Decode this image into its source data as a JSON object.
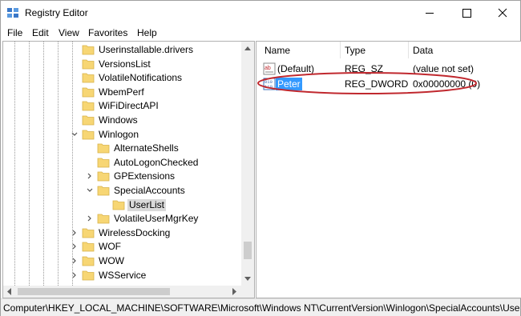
{
  "window": {
    "title": "Registry Editor"
  },
  "menu": [
    "File",
    "Edit",
    "View",
    "Favorites",
    "Help"
  ],
  "tree": {
    "items": [
      {
        "label": "Userinstallable.drivers",
        "expander": "none"
      },
      {
        "label": "VersionsList",
        "expander": "none"
      },
      {
        "label": "VolatileNotifications",
        "expander": "none"
      },
      {
        "label": "WbemPerf",
        "expander": "none"
      },
      {
        "label": "WiFiDirectAPI",
        "expander": "none"
      },
      {
        "label": "Windows",
        "expander": "none"
      },
      {
        "label": "Winlogon",
        "expander": "expanded"
      },
      {
        "label": "AlternateShells",
        "expander": "none"
      },
      {
        "label": "AutoLogonChecked",
        "expander": "none"
      },
      {
        "label": "GPExtensions",
        "expander": "collapsed"
      },
      {
        "label": "SpecialAccounts",
        "expander": "expanded"
      },
      {
        "label": "UserList",
        "expander": "none",
        "selected": true
      },
      {
        "label": "VolatileUserMgrKey",
        "expander": "collapsed"
      },
      {
        "label": "WirelessDocking",
        "expander": "collapsed"
      },
      {
        "label": "WOF",
        "expander": "collapsed"
      },
      {
        "label": "WOW",
        "expander": "collapsed"
      },
      {
        "label": "WSService",
        "expander": "collapsed"
      }
    ]
  },
  "values": {
    "columns": [
      "Name",
      "Type",
      "Data"
    ],
    "rows": [
      {
        "name": "(Default)",
        "type": "REG_SZ",
        "data": "(value not set)",
        "icon": "string-value-icon"
      },
      {
        "name": "Peter",
        "type": "REG_DWORD",
        "data": "0x00000000 (0)",
        "icon": "binary-value-icon",
        "selected": true,
        "highlighted": true
      }
    ]
  },
  "status": {
    "path": "Computer\\HKEY_LOCAL_MACHINE\\SOFTWARE\\Microsoft\\Windows NT\\CurrentVersion\\Winlogon\\SpecialAccounts\\UserList"
  },
  "colors": {
    "selection": "#3399ff",
    "highlight_ellipse": "#c0282e",
    "folder": "#f7d674"
  }
}
